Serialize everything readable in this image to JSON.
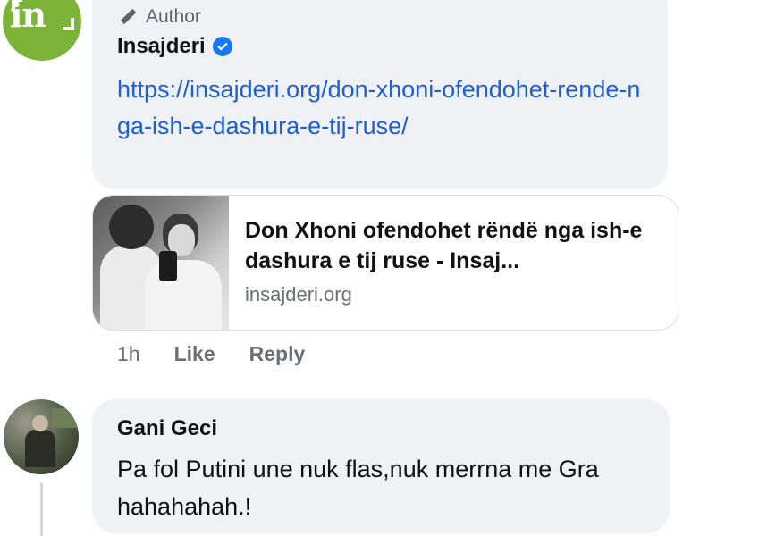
{
  "comment1": {
    "author_badge": "Author",
    "author_badge_icon": "pencil-icon",
    "name": "Insajderi",
    "verified": true,
    "link": "https://insajderi.org/don-xhoni-ofendohet-rende-nga-ish-e-dashura-e-tij-ruse/",
    "preview": {
      "title": "Don Xhoni ofendohet rëndë nga ish-e dashura e tij ruse - Insaj...",
      "domain": "insajderi.org"
    },
    "time": "1h",
    "like_label": "Like",
    "reply_label": "Reply"
  },
  "comment2": {
    "name": "Gani Geci",
    "text": "Pa fol Putini une nuk flas,nuk merrna me Gra  hahahahah.!"
  },
  "colors": {
    "bubble": "#eff1f4",
    "link": "#1d5fd6",
    "verified": "#1877f2",
    "brand_green": "#7cb43a"
  }
}
